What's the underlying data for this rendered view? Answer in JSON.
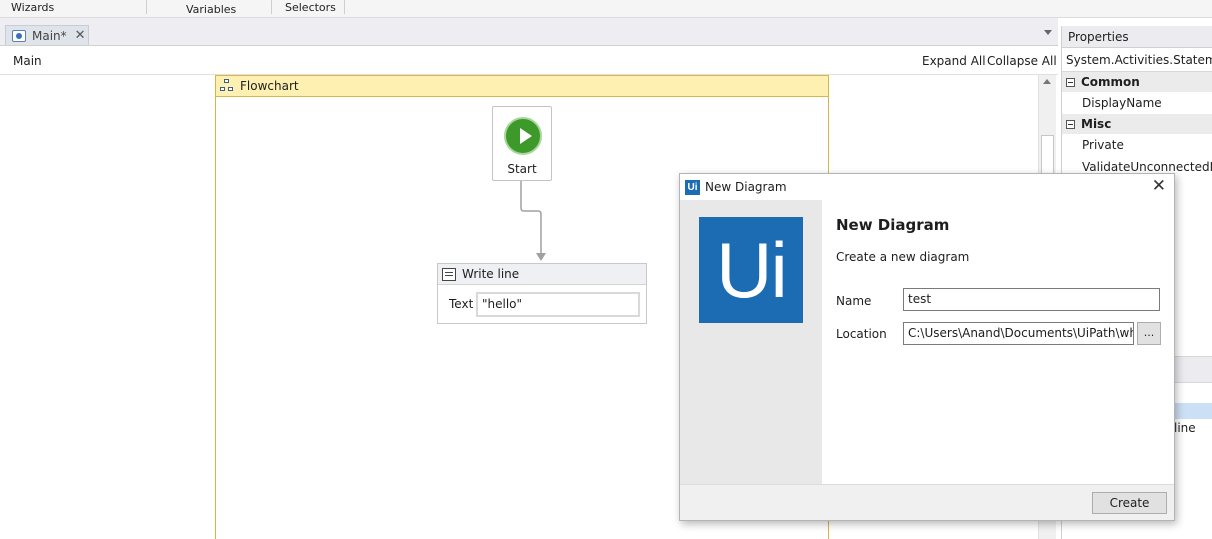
{
  "ribbon": {
    "groups": [
      "Wizards",
      "Variables",
      "Selectors"
    ]
  },
  "document": {
    "tab_label": "Main*",
    "tab_close": "✕",
    "breadcrumb": "Main",
    "expand_all": "Expand All",
    "collapse_all": "Collapse All"
  },
  "flowchart": {
    "title": "Flowchart",
    "start_label": "Start",
    "write_line": {
      "title": "Write line",
      "text_label": "Text",
      "text_value": "\"hello\""
    }
  },
  "properties": {
    "title": "Properties",
    "type_name": "System.Activities.Statements.Flowchart",
    "categories": [
      {
        "name": "Common",
        "rows": [
          "DisplayName"
        ]
      },
      {
        "name": "Misc",
        "rows": [
          "Private",
          "ValidateUnconnectedNodes"
        ]
      }
    ],
    "lower_item": "line"
  },
  "dialog": {
    "title": "New Diagram",
    "logo_small": "Ui",
    "logo_large": "Ui",
    "close": "✕",
    "heading": "New Diagram",
    "subtitle": "Create a new diagram",
    "name_label": "Name",
    "name_value": "test",
    "location_label": "Location",
    "location_value": "C:\\Users\\Anand\\Documents\\UiPath\\what a",
    "browse_label": "...",
    "create_label": "Create"
  },
  "colors": {
    "flowchart_header": "#fdf0b0",
    "flowchart_border": "#d8b44a",
    "start_green": "#3d9a2a",
    "uipath_blue": "#1b6cb3"
  }
}
